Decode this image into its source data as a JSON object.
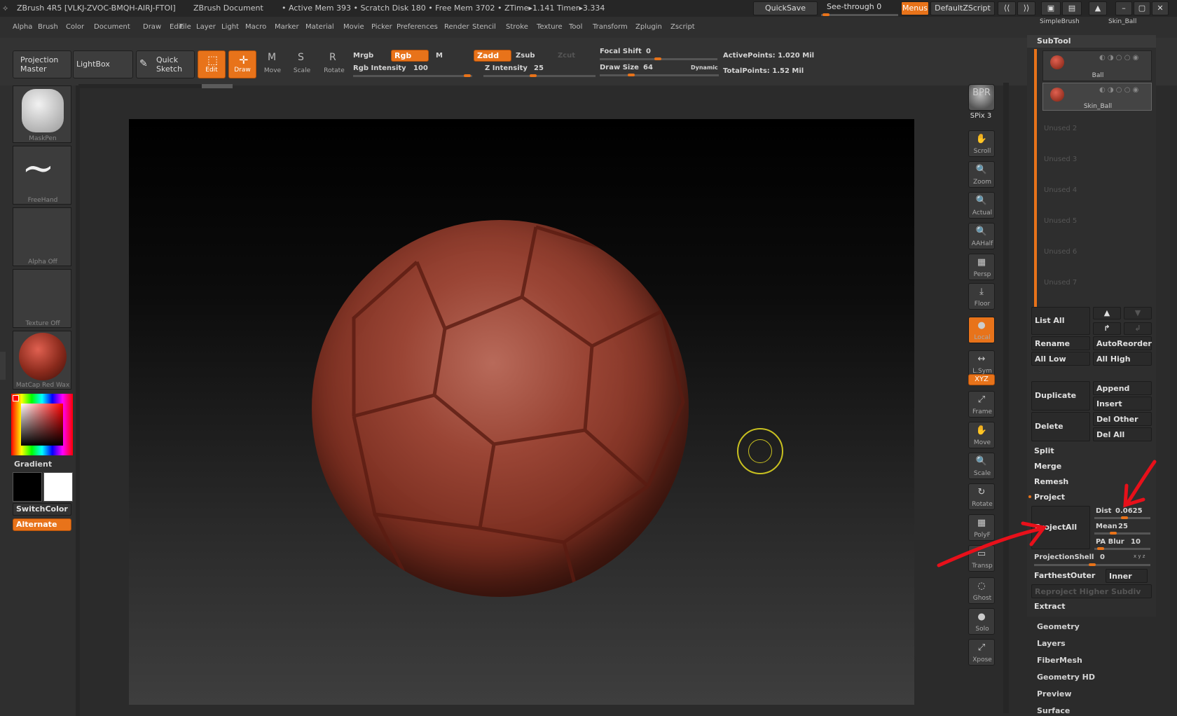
{
  "titlebar": {
    "app": "ZBrush 4R5 [VLKJ-ZVOC-BMQH-AIRJ-FTOI]",
    "doc": "ZBrush Document",
    "stats": "• Active Mem 393 • Scratch Disk 180 • Free Mem 3702 • ZTime▸1.141 Timer▸3.334",
    "quicksave": "QuickSave",
    "seethrough": "See-through  0",
    "menus": "Menus",
    "script": "DefaultZScript"
  },
  "menubar": [
    "Alpha",
    "Brush",
    "Color",
    "Document",
    "Draw",
    "Edit",
    "File",
    "Layer",
    "Light",
    "Macro",
    "Marker",
    "Material",
    "Movie",
    "Picker",
    "Preferences",
    "Render",
    "Stencil",
    "Stroke",
    "Texture",
    "Tool",
    "Transform",
    "Zplugin",
    "Zscript"
  ],
  "shelf": {
    "projection_master": "Projection Master",
    "lightbox": "LightBox",
    "quick_sketch": "Quick Sketch",
    "edit": "Edit",
    "draw": "Draw",
    "move": "Move",
    "scale": "Scale",
    "rotate": "Rotate",
    "mrgb": "Mrgb",
    "rgb": "Rgb",
    "m": "M",
    "zadd": "Zadd",
    "zsub": "Zsub",
    "zcut": "Zcut",
    "rgb_intensity_label": "Rgb Intensity",
    "rgb_intensity": "100",
    "z_intensity_label": "Z Intensity",
    "z_intensity": "25",
    "focal_shift_label": "Focal Shift",
    "focal_shift": "0",
    "draw_size_label": "Draw Size",
    "draw_size": "64",
    "dynamic": "Dynamic",
    "active_points": "ActivePoints: 1.020  Mil",
    "total_points": "TotalPoints: 1.52 Mil"
  },
  "left": {
    "maskpen": "MaskPen",
    "freehand": "FreeHand",
    "alpha": "Alpha  Off",
    "texture": "Texture  Off",
    "matcap": "MatCap  Red  Wax",
    "gradient": "Gradient",
    "switchcolor": "SwitchColor",
    "alternate": "Alternate"
  },
  "righttools": [
    {
      "name": "bpr",
      "label": "",
      "icon": "BPR"
    },
    {
      "name": "spix",
      "label": "SPix 3",
      "icon": ""
    },
    {
      "name": "scroll",
      "label": "Scroll",
      "icon": "✋"
    },
    {
      "name": "zoom",
      "label": "Zoom",
      "icon": "🔍"
    },
    {
      "name": "actual",
      "label": "Actual",
      "icon": "🔍"
    },
    {
      "name": "aahalf",
      "label": "AAHalf",
      "icon": "🔍"
    },
    {
      "name": "persp",
      "label": "Persp",
      "icon": "▦"
    },
    {
      "name": "floor",
      "label": "Floor",
      "icon": "⤓"
    },
    {
      "name": "local",
      "label": "Local",
      "icon": "●"
    },
    {
      "name": "lsym",
      "label": "L.Sym",
      "icon": "↔"
    },
    {
      "name": "xyz",
      "label": "XYZ",
      "icon": ""
    },
    {
      "name": "frame",
      "label": "Frame",
      "icon": "⤢"
    },
    {
      "name": "move",
      "label": "Move",
      "icon": "✋"
    },
    {
      "name": "scale",
      "label": "Scale",
      "icon": "🔍"
    },
    {
      "name": "rotate",
      "label": "Rotate",
      "icon": "↻"
    },
    {
      "name": "polyf",
      "label": "PolyF",
      "icon": "▦"
    },
    {
      "name": "transp",
      "label": "Transp",
      "icon": "▭"
    },
    {
      "name": "ghost",
      "label": "Ghost",
      "icon": "◌"
    },
    {
      "name": "solo",
      "label": "Solo",
      "icon": "●"
    },
    {
      "name": "xpose",
      "label": "Xpose",
      "icon": "⤢"
    }
  ],
  "subtool": {
    "top_brushes": [
      "SimpleBrush",
      "Skin_Ball"
    ],
    "title": "SubTool",
    "items": [
      "Ball",
      "Skin_Ball"
    ],
    "unused": [
      "Unused  2",
      "Unused  3",
      "Unused  4",
      "Unused  5",
      "Unused  6",
      "Unused  7"
    ],
    "list_all": "List  All",
    "rename": "Rename",
    "autoreorder": "AutoReorder",
    "all_low": "All  Low",
    "all_high": "All  High",
    "duplicate": "Duplicate",
    "append": "Append",
    "insert": "Insert",
    "delete": "Delete",
    "del_other": "Del  Other",
    "del_all": "Del  All",
    "split": "Split",
    "merge": "Merge",
    "remesh": "Remesh",
    "project": "Project",
    "projectall": "ProjectAll",
    "dist_label": "Dist",
    "dist": "0.0625",
    "mean_label": "Mean",
    "mean": "25",
    "pablur_label": "PA  Blur",
    "pablur": "10",
    "projshell_label": "ProjectionShell",
    "projshell": "0",
    "xyz": "x y z",
    "farthest": "Farthest",
    "outer": "Outer",
    "inner": "Inner",
    "reproject": "Reproject  Higher  Subdiv",
    "extract": "Extract"
  },
  "subpalettes": [
    "Geometry",
    "Layers",
    "FiberMesh",
    "Geometry HD",
    "Preview",
    "Surface"
  ]
}
